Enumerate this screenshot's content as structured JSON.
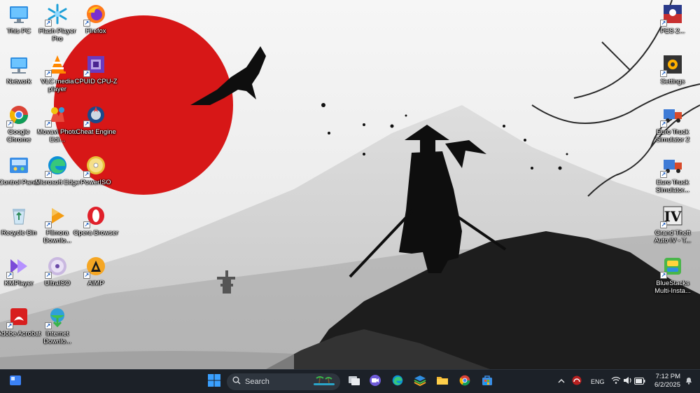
{
  "desktop": {
    "icons": [
      {
        "id": "this-pc",
        "label": "This PC",
        "col": 0,
        "row": 0,
        "icon": "monitor-icon"
      },
      {
        "id": "flash-player",
        "label": "Flash Player Pro",
        "col": 1,
        "row": 0,
        "icon": "snowflake-icon"
      },
      {
        "id": "firefox",
        "label": "Firefox",
        "col": 2,
        "row": 0,
        "icon": "firefox-icon"
      },
      {
        "id": "network",
        "label": "Network",
        "col": 0,
        "row": 1,
        "icon": "network-icon"
      },
      {
        "id": "vlc",
        "label": "VLC media player",
        "col": 1,
        "row": 1,
        "icon": "vlc-cone-icon"
      },
      {
        "id": "cpuz",
        "label": "CPUID CPU-Z",
        "col": 2,
        "row": 1,
        "icon": "cpu-icon"
      },
      {
        "id": "chrome",
        "label": "Google Chrome",
        "col": 0,
        "row": 2,
        "icon": "chrome-icon"
      },
      {
        "id": "movavi",
        "label": "Movavi Photo Edi...",
        "col": 1,
        "row": 2,
        "icon": "movavi-icon"
      },
      {
        "id": "cheat-engine",
        "label": "Cheat Engine",
        "col": 2,
        "row": 2,
        "icon": "cheat-engine-icon"
      },
      {
        "id": "control-panel",
        "label": "Control Panel",
        "col": 0,
        "row": 3,
        "icon": "control-panel-icon"
      },
      {
        "id": "edge",
        "label": "Microsoft Edge",
        "col": 1,
        "row": 3,
        "icon": "edge-icon"
      },
      {
        "id": "poweriso",
        "label": "PowerISO",
        "col": 2,
        "row": 3,
        "icon": "disc-icon"
      },
      {
        "id": "recycle-bin",
        "label": "Recycle Bin",
        "col": 0,
        "row": 4,
        "icon": "recycle-bin-icon"
      },
      {
        "id": "filmora",
        "label": "Filmora Downlo...",
        "col": 1,
        "row": 4,
        "icon": "filmora-icon"
      },
      {
        "id": "opera",
        "label": "Opera Browser",
        "col": 2,
        "row": 4,
        "icon": "opera-icon"
      },
      {
        "id": "kmplayer",
        "label": "KMPlayer",
        "col": 0,
        "row": 5,
        "icon": "kmplayer-icon"
      },
      {
        "id": "ultraiso",
        "label": "UltraISO",
        "col": 1,
        "row": 5,
        "icon": "ultraiso-icon"
      },
      {
        "id": "aimp",
        "label": "AIMP",
        "col": 2,
        "row": 5,
        "icon": "aimp-icon"
      },
      {
        "id": "acrobat",
        "label": "Adobe Acrobat",
        "col": 0,
        "row": 6,
        "icon": "acrobat-icon"
      },
      {
        "id": "idm",
        "label": "Internet Downlo...",
        "col": 1,
        "row": 6,
        "icon": "idm-icon"
      }
    ],
    "right_icons": [
      {
        "id": "pes",
        "label": "PES 2...",
        "row": 0,
        "icon": "pes-icon"
      },
      {
        "id": "settings",
        "label": "Settings",
        "row": 1,
        "icon": "settings-gear-icon"
      },
      {
        "id": "ets2",
        "label": "Euro Truck Simulator 2",
        "row": 2,
        "icon": "truck-icon"
      },
      {
        "id": "ets2b",
        "label": "Euro Truck Simulator...",
        "row": 3,
        "icon": "truck-icon"
      },
      {
        "id": "gta4",
        "label": "Grand Theft Auto IV - T...",
        "row": 4,
        "icon": "gta-icon"
      },
      {
        "id": "bluestacks",
        "label": "BlueStacks Multi-Insta...",
        "row": 5,
        "icon": "bluestacks-icon"
      }
    ]
  },
  "taskbar": {
    "search_placeholder": "Search",
    "language": "ENG",
    "time": "7:12 PM",
    "date": "6/2/2025",
    "pinned": [
      "task-view-icon",
      "meet-icon",
      "edge-icon",
      "store-stack-icon",
      "file-explorer-icon",
      "chrome-icon",
      "ms-store-icon"
    ],
    "colors": {
      "bg": "#1c2128",
      "accent": "#0078d4"
    }
  }
}
